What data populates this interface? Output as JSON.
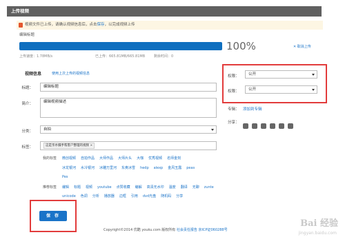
{
  "panel_title": "上传视频",
  "notice": {
    "text": "视频文件已上传，请确认视频信息后，点击",
    "link": "保存",
    "text2": "，以完成视频上传"
  },
  "video_title_label": "编辑标题",
  "upload": {
    "progress": 100,
    "percent_text": "100%",
    "cancel": "取消上传",
    "speed": "上传速度：1.78MB/s",
    "uploaded": "已上传：665.81MB/665.81MB",
    "remaining": "剩余时间：0"
  },
  "form": {
    "section_label": "视频信息",
    "last_info_link": "使用上次上传的视频信息",
    "title_label": "标题：",
    "title_value": "编辑标题",
    "desc_label": "简介：",
    "desc_value": "编辑视频描述",
    "category_label": "分类：",
    "category_value": "自拍",
    "tags_label": "标签：",
    "tag_chip": "这是亲水摄手帮客户整理的视频",
    "recommended_label": "我的标签",
    "recommended_tags_row1": [
      "微创视频",
      "自拍作品",
      "大师作品",
      "大师片头",
      "大咖",
      "优秀视频",
      "名师金刻"
    ],
    "recommended_tags_row2": [
      "冰龙银河",
      "水冷银河",
      "冰雕万里河",
      "东奥冰雪",
      "hedp",
      "alexp",
      "金风玉露",
      "peas"
    ],
    "recommended_tags_row3": [
      "Pes"
    ],
    "hot_label": "推荐标签",
    "hot_tags_row1": [
      "编辑",
      "标题",
      "视频",
      "youtube",
      "点赞收藏",
      "编解",
      "高清无水印",
      "温度",
      "翻译",
      "无聊",
      "zunte"
    ],
    "hot_tags_row2": [
      "unicode",
      "色调",
      "分析",
      "播放器",
      "边框",
      "引用",
      "dvd光盘",
      "随机码",
      "分享"
    ]
  },
  "side": {
    "privacy_label": "权限：",
    "privacy_value": "公开",
    "audience_label": "权限：",
    "audience_value": "公开",
    "album_label": "专辑：",
    "album_link": "添加到专辑",
    "share_label": "分享："
  },
  "save_label": "保 存",
  "footer": {
    "copyright": "Copyright©2014 优酷 youku.com 版权所有",
    "link1": "社会责任报告",
    "link2": "京ICP证060288号"
  },
  "watermark": {
    "main": "Bai 经验",
    "sub": "jingyan.baidu.com"
  },
  "colors": {
    "accent": "#1a73c8",
    "highlight": "#e23b3b",
    "titlebar": "#606060"
  }
}
